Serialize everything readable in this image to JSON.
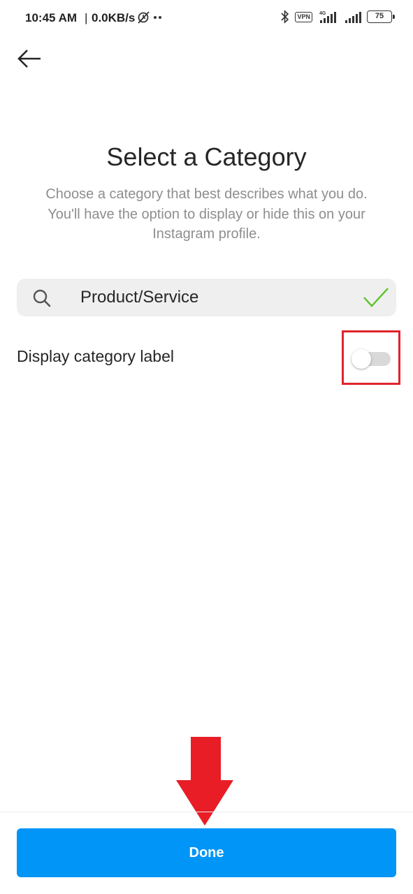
{
  "status_bar": {
    "time": "10:45 AM",
    "separator": "|",
    "network_speed": "0.0KB/s",
    "vpn_label": "VPN",
    "network_type": "4G",
    "battery_level": "75",
    "icons": [
      "alarm-off-icon",
      "more-dots-icon",
      "bluetooth-icon",
      "vpn-icon",
      "signal-4g-icon",
      "signal-icon",
      "battery-icon"
    ]
  },
  "header": {
    "back_icon": "arrow-left-icon"
  },
  "main": {
    "title": "Select a Category",
    "subtitle": "Choose a category that best describes what you do. You'll have the option to display or hide this on your Instagram profile.",
    "search": {
      "icon": "search-icon",
      "value": "Product/Service",
      "valid_icon": "checkmark-icon",
      "valid_color": "#58c322"
    },
    "display_label_toggle": {
      "label": "Display category label",
      "on": false
    }
  },
  "annotations": {
    "highlight_color": "#e0242d",
    "arrow_color": "#e81d25"
  },
  "footer": {
    "done_label": "Done",
    "button_color": "#0095f6"
  }
}
